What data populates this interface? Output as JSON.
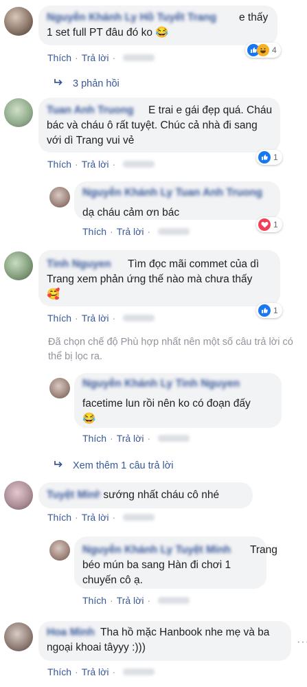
{
  "reactions": {
    "like_color": "#1877f2",
    "love_color": "#f33e58",
    "haha_color": "#f7b125"
  },
  "comments": [
    {
      "name": "Nguyễn Khánh Ly Hồ Tuyết Trang",
      "text": "e thấy 1 set full PT đâu đó ko",
      "emoji": "😂",
      "actions": {
        "like": "Thích",
        "reply": "Trả lời"
      },
      "reactions": {
        "icons": [
          "like-icon",
          "haha-icon"
        ],
        "count": "4"
      },
      "replies_link": "3 phản hồi"
    },
    {
      "name": "Tuan Anh Truong",
      "text": "E trai e gái đẹp quá. Cháu bác và cháu ô rất tuyệt. Chúc cả nhà đi sang với dì Trang vui vẻ",
      "actions": {
        "like": "Thích",
        "reply": "Trả lời"
      },
      "reactions": {
        "icons": [
          "like-icon"
        ],
        "count": "1"
      }
    },
    {
      "name": "Nguyễn Khánh Ly Tuan Anh Truong",
      "text": "dạ cháu cảm ơn bác",
      "actions": {
        "like": "Thích",
        "reply": "Trả lời"
      },
      "reactions": {
        "icons": [
          "love-icon"
        ],
        "count": "1"
      }
    },
    {
      "name": "Tinh Nguyen",
      "text": "Tìm đọc mãi commet của dì Trang xem phản ứng thế nào mà chưa thấy",
      "emoji": "🥰",
      "actions": {
        "like": "Thích",
        "reply": "Trả lời"
      },
      "reactions": {
        "icons": [
          "like-icon"
        ],
        "count": "1"
      }
    },
    {
      "name": "Nguyễn Khánh Ly Tinh Nguyen",
      "text": "facetime lun rồi nên ko có đoạn đấy",
      "emoji": "😂",
      "actions": {
        "like": "Thích",
        "reply": "Trả lời"
      }
    },
    {
      "name": "Tuyệt Minh",
      "text": "sướng nhất cháu cô nhé",
      "actions": {
        "like": "Thích",
        "reply": "Trả lời"
      }
    },
    {
      "name": "Nguyễn Khánh Ly Tuyệt Minh",
      "text": "Trang béo mún ba sang Hàn đi chơi 1 chuyến cô ạ.",
      "actions": {
        "like": "Thích",
        "reply": "Trả lời"
      }
    },
    {
      "name": "Hoa Minh",
      "text": "Tha hồ mặc Hanbook nhe mẹ và ba ngoại khoai tâyyy :)))",
      "actions": {
        "like": "Thích",
        "reply": "Trả lời"
      }
    }
  ],
  "filter_notice": "Đã chọn chế độ Phù hợp nhất nên một số câu trả lời có thể bị lọc ra.",
  "see_more_link": "Xem thêm 1 câu trả lời"
}
